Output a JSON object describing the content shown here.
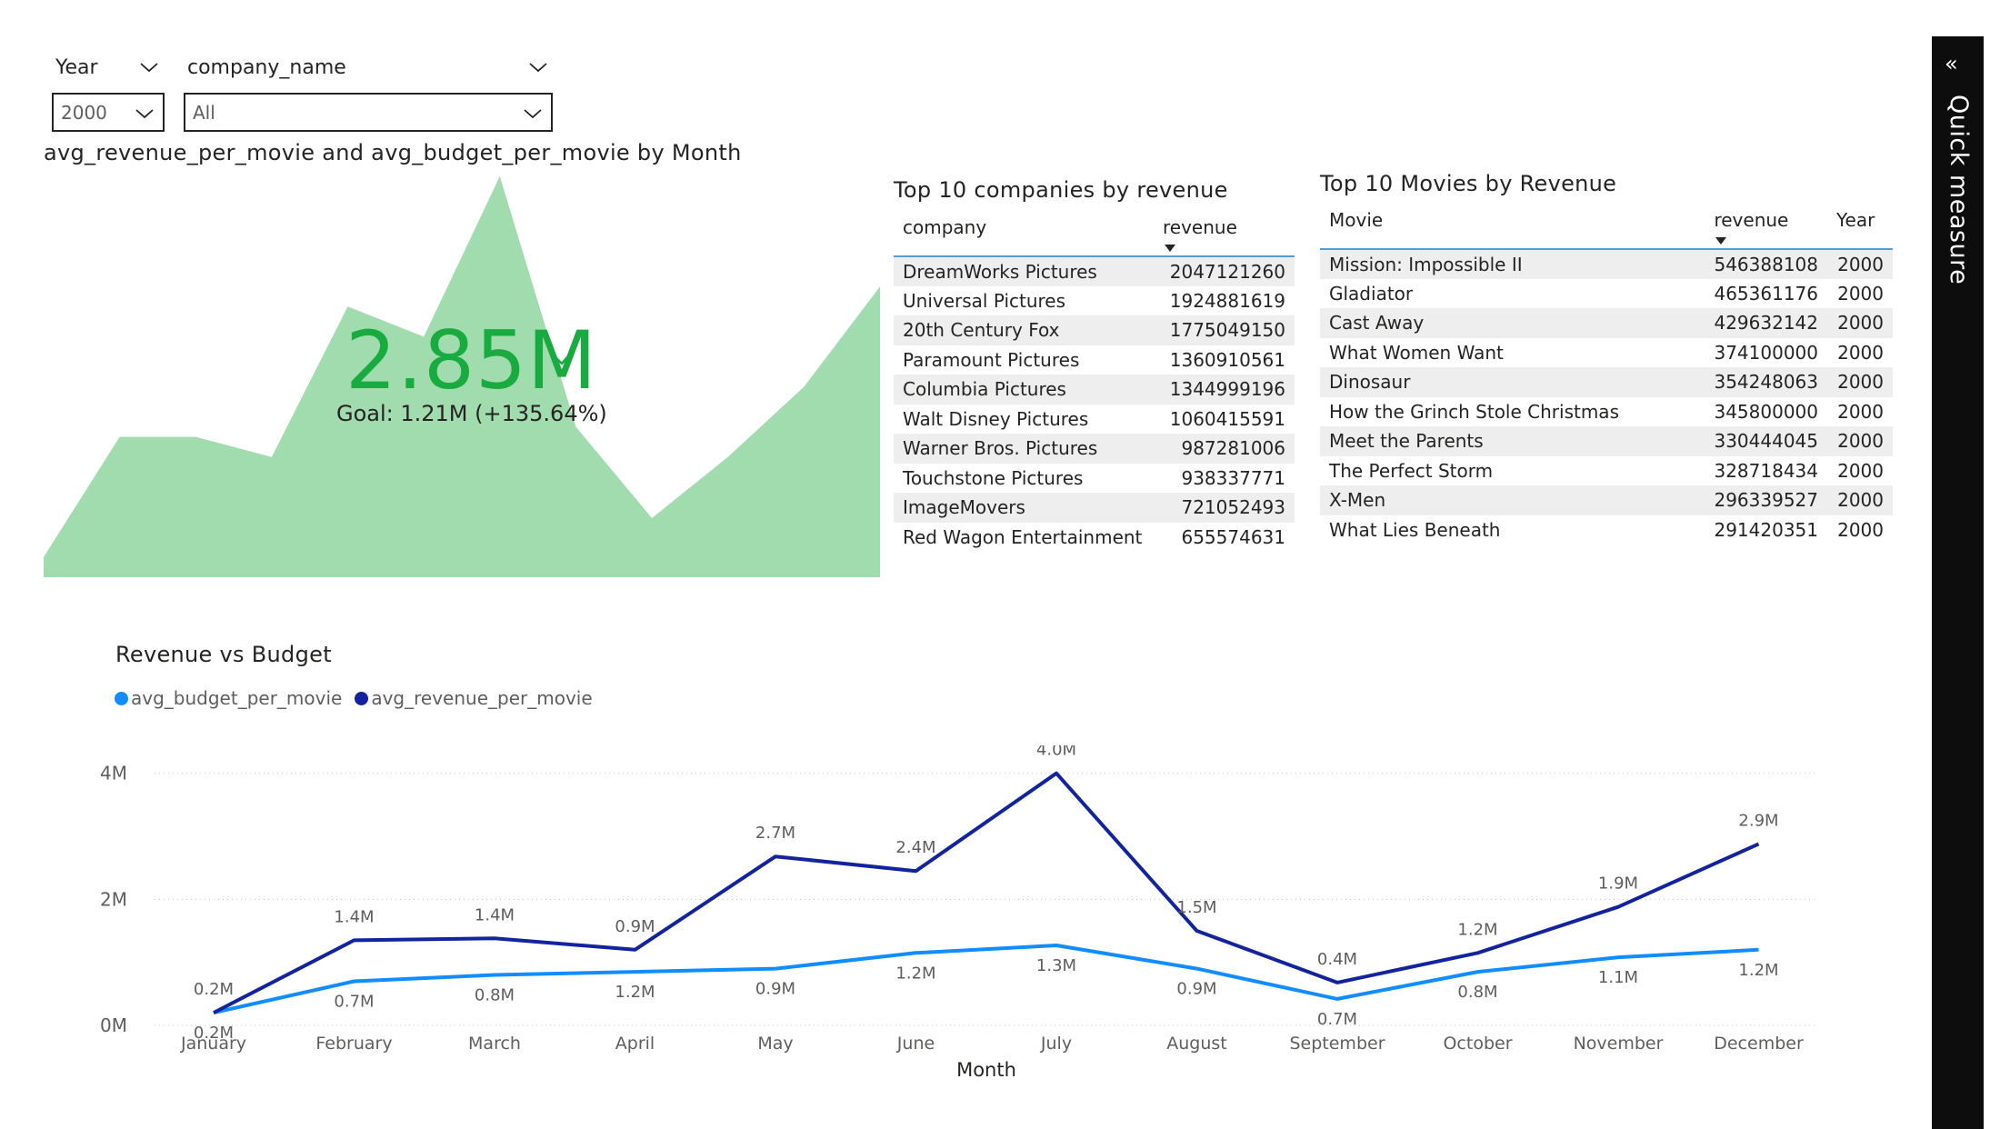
{
  "slicers": {
    "year": {
      "label": "Year",
      "value": "2000"
    },
    "company": {
      "label": "company_name",
      "value": "All"
    }
  },
  "kpi": {
    "title": "avg_revenue_per_movie and avg_budget_per_movie by Month",
    "value": "2.85M",
    "goal": "Goal: 1.21M (+135.64%)",
    "fill_color": "#a0dcae",
    "value_color": "#1aab40"
  },
  "companies_table": {
    "title": "Top 10 companies by revenue",
    "columns": [
      "company",
      "revenue"
    ],
    "rows": [
      [
        "DreamWorks Pictures",
        "2047121260"
      ],
      [
        "Universal Pictures",
        "1924881619"
      ],
      [
        "20th Century Fox",
        "1775049150"
      ],
      [
        "Paramount Pictures",
        "1360910561"
      ],
      [
        "Columbia Pictures",
        "1344999196"
      ],
      [
        "Walt Disney Pictures",
        "1060415591"
      ],
      [
        "Warner Bros. Pictures",
        "987281006"
      ],
      [
        "Touchstone Pictures",
        "938337771"
      ],
      [
        "ImageMovers",
        "721052493"
      ],
      [
        "Red Wagon Entertainment",
        "655574631"
      ]
    ]
  },
  "movies_table": {
    "title": "Top 10 Movies by Revenue",
    "columns": [
      "Movie",
      "revenue",
      "Year"
    ],
    "rows": [
      [
        "Mission: Impossible II",
        "546388108",
        "2000"
      ],
      [
        "Gladiator",
        "465361176",
        "2000"
      ],
      [
        "Cast Away",
        "429632142",
        "2000"
      ],
      [
        "What Women Want",
        "374100000",
        "2000"
      ],
      [
        "Dinosaur",
        "354248063",
        "2000"
      ],
      [
        "How the Grinch Stole Christmas",
        "345800000",
        "2000"
      ],
      [
        "Meet the Parents",
        "330444045",
        "2000"
      ],
      [
        "The Perfect Storm",
        "328718434",
        "2000"
      ],
      [
        "X-Men",
        "296339527",
        "2000"
      ],
      [
        "What Lies Beneath",
        "291420351",
        "2000"
      ]
    ]
  },
  "line_chart": {
    "title": "Revenue vs Budget",
    "xlabel": "Month"
  },
  "side_panel": {
    "label": "Quick measure",
    "collapse_glyph": "«"
  },
  "chart_data": [
    {
      "type": "area",
      "title": "avg_revenue_per_movie and avg_budget_per_movie by Month",
      "categories": [
        "January",
        "February",
        "March",
        "April",
        "May",
        "June",
        "July",
        "August",
        "September",
        "October",
        "November",
        "December"
      ],
      "values": [
        0.2,
        1.4,
        1.4,
        1.2,
        2.7,
        2.4,
        4.0,
        1.5,
        0.59,
        1.2,
        1.9,
        2.9
      ],
      "ylim": [
        0,
        4.0
      ],
      "color": "#a0dcae"
    },
    {
      "type": "line",
      "title": "Revenue vs Budget",
      "xlabel": "Month",
      "ylabel": "",
      "categories": [
        "January",
        "February",
        "March",
        "April",
        "May",
        "June",
        "July",
        "August",
        "September",
        "October",
        "November",
        "December"
      ],
      "ylim": [
        0,
        4.4
      ],
      "yticks": [
        0,
        2,
        4
      ],
      "ytick_labels": [
        "0M",
        "2M",
        "4M"
      ],
      "grid": true,
      "legend": "top-left",
      "series": [
        {
          "name": "avg_budget_per_movie",
          "color": "#118dff",
          "values": [
            0.2,
            0.7,
            0.8,
            0.85,
            0.9,
            1.15,
            1.27,
            0.9,
            0.42,
            0.85,
            1.08,
            1.2
          ],
          "labels": [
            "0.2M",
            "0.7M",
            "0.8M",
            "1.2M",
            "0.9M",
            "1.2M",
            "1.3M",
            "0.9M",
            "0.7M",
            "0.8M",
            "1.1M",
            "1.2M"
          ]
        },
        {
          "name": "avg_revenue_per_movie",
          "color": "#12239e",
          "values": [
            0.2,
            1.35,
            1.38,
            1.2,
            2.68,
            2.45,
            4.0,
            1.5,
            0.68,
            1.15,
            1.88,
            2.88
          ],
          "labels": [
            "0.2M",
            "1.4M",
            "1.4M",
            "0.9M",
            "2.7M",
            "2.4M",
            "4.0M",
            "1.5M",
            "0.4M",
            "1.2M",
            "1.9M",
            "2.9M"
          ]
        }
      ]
    }
  ]
}
